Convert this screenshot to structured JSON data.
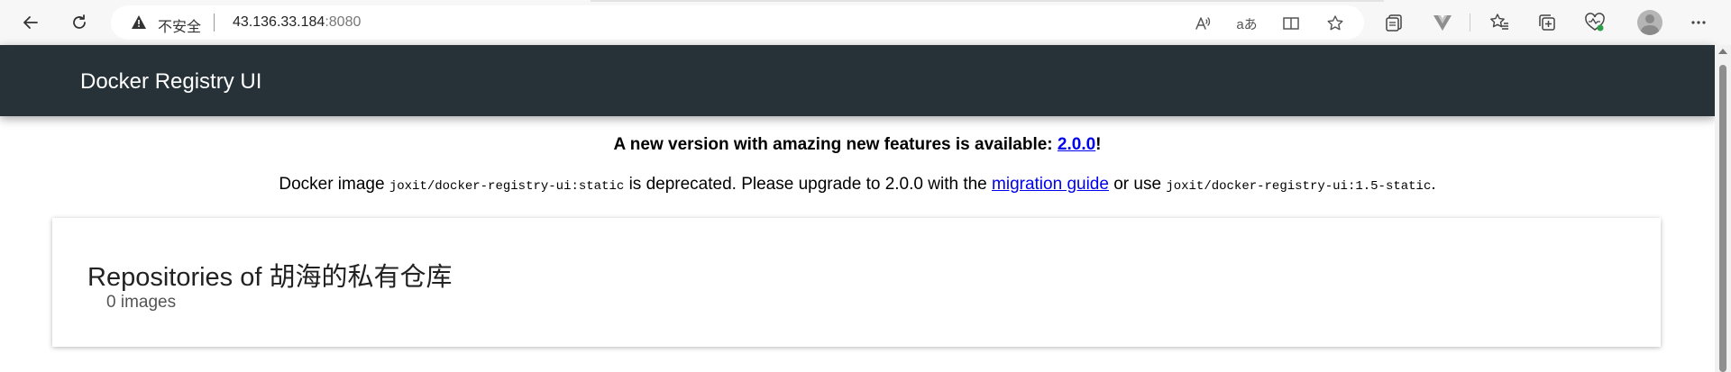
{
  "browser": {
    "security_label": "不安全",
    "url_host": "43.136.33.184",
    "url_port": ":8080",
    "translate_glyph": "aあ"
  },
  "header": {
    "title": "Docker Registry UI",
    "bg_color": "#263238"
  },
  "banner": {
    "line1_prefix": "A new version with amazing new features is available: ",
    "line1_link": "2.0.0",
    "line1_suffix": "!",
    "line2_part1": "Docker image ",
    "line2_code1": "joxit/docker-registry-ui:static",
    "line2_part2": " is deprecated. Please upgrade to 2.0.0 with the ",
    "line2_link": "migration guide",
    "line2_part3": " or use ",
    "line2_code2": "joxit/docker-registry-ui:1.5-static",
    "line2_end": ".",
    "link_color": "#0000ee"
  },
  "repositories": {
    "title": "Repositories of 胡海的私有仓库",
    "count_text": "0 images"
  }
}
